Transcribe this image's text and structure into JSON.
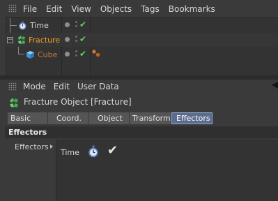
{
  "menubar": {
    "items": [
      "File",
      "Edit",
      "View",
      "Objects",
      "Tags",
      "Bookmarks"
    ]
  },
  "objects": [
    {
      "name": "Time",
      "color": "#d0d0d0",
      "icon": "stopwatch-icon"
    },
    {
      "name": "Fracture",
      "color": "#f0a020",
      "icon": "fracture-icon"
    },
    {
      "name": "Cube",
      "color": "#c87a3a",
      "icon": "cube-icon"
    }
  ],
  "attributes": {
    "menubar": [
      "Mode",
      "Edit",
      "User Data"
    ],
    "title": "Fracture Object [Fracture]",
    "tabs": [
      "Basic",
      "Coord.",
      "Object",
      "Transform",
      "Effectors"
    ],
    "active_tab": "Effectors",
    "section": "Effectors",
    "effectors_label": "Effectors",
    "list_columns": {
      "name": "Time",
      "enabled": "✔"
    }
  },
  "colors": {
    "check_green": "#5fd35f",
    "active_tab": "#5c6d8c",
    "orange_highlight": "#f0a020"
  }
}
